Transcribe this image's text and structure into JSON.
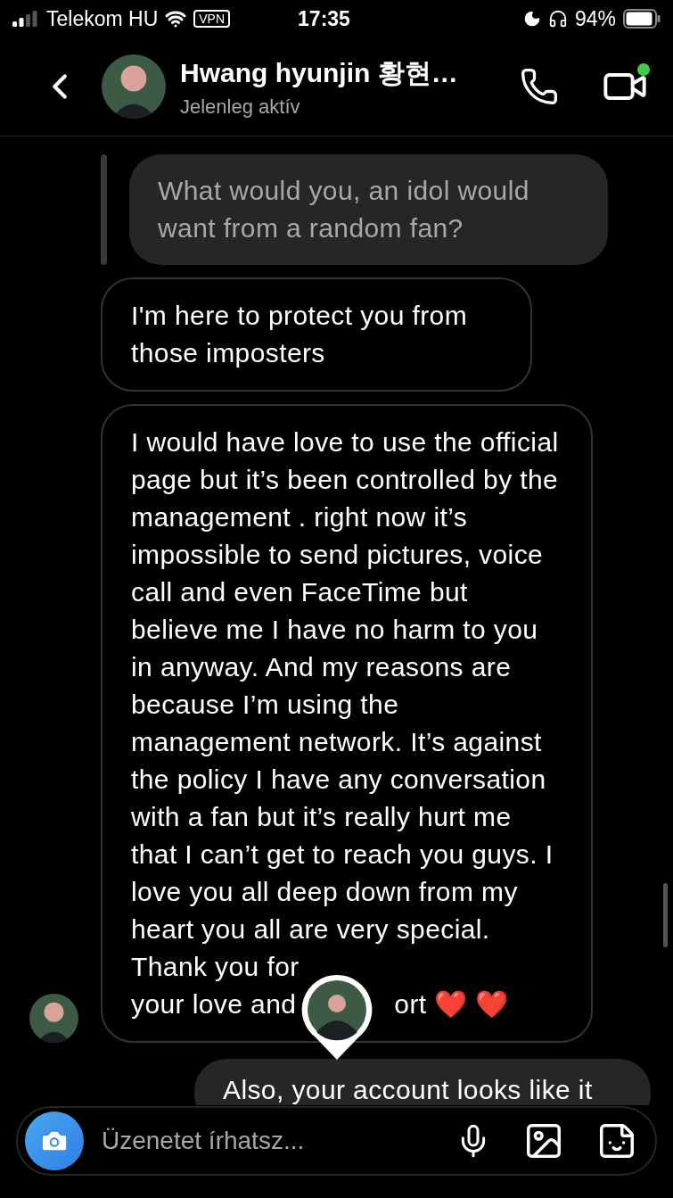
{
  "status_bar": {
    "carrier": "Telekom HU",
    "vpn": "VPN",
    "time": "17:35",
    "battery": "94%"
  },
  "header": {
    "name": "Hwang hyunjin 황현…",
    "status": "Jelenleg aktív"
  },
  "messages": [
    {
      "kind": "quote",
      "text": "What would you, an idol would want from a random fan?"
    },
    {
      "kind": "received",
      "text": "I'm here to protect you from those imposters"
    },
    {
      "kind": "received_covered",
      "text": "I would have love to use the official page but it’s been controlled by the management . right now it’s impossible to send pictures, voice call and even FaceTime but believe me I have no harm to you in anyway. And my reasons are because I’m using the management network. It’s against the policy I have any conversation with a fan but it’s really hurt me that I can’t get to reach you guys. I love you all deep down from my heart you all are very special. Thank you for",
      "line_start": "your love and",
      "line_end": "ort ❤️ ❤️"
    },
    {
      "kind": "sent",
      "text": "Also, your account looks like it"
    }
  ],
  "composer": {
    "placeholder": "Üzenetet írhatsz..."
  }
}
